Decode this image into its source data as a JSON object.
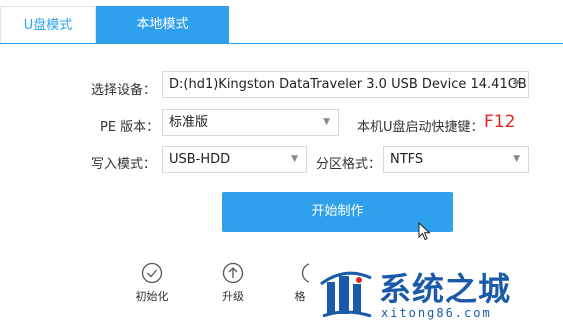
{
  "tabs": [
    {
      "label": "U盘模式"
    },
    {
      "label": "本地模式"
    }
  ],
  "form": {
    "device_label": "选择设备：",
    "device_value": "D:(hd1)Kingston DataTraveler 3.0 USB Device 14.41GB",
    "pe_label": "PE 版本：",
    "pe_value": "标准版",
    "hotkey_label": "本机U盘启动快捷键：",
    "hotkey_value": "F12",
    "write_label": "写入模式：",
    "write_value": "USB-HDD",
    "partition_label": "分区格式：",
    "partition_value": "NTFS"
  },
  "start_button": {
    "label": "开始制作"
  },
  "tools": [
    {
      "label": "初始化",
      "icon": "check-circle-icon"
    },
    {
      "label": "升级",
      "icon": "arrow-up-circle-icon"
    },
    {
      "label": "格",
      "icon": "format-icon"
    }
  ],
  "watermark": {
    "title": "系统之城",
    "url": "xitong86.com",
    "color": "#1a5aa8"
  },
  "colors": {
    "accent": "#2ea0ec",
    "hotkey": "#e0281c"
  }
}
